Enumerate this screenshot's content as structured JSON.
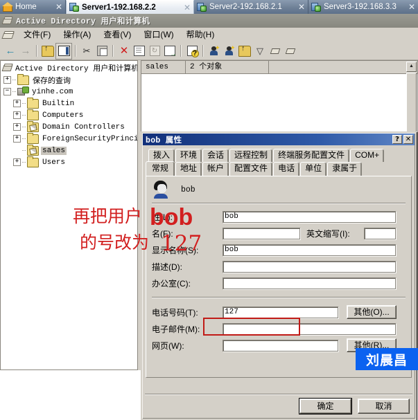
{
  "browser": {
    "tabs": [
      {
        "label": "Home",
        "icon": "home-icon",
        "active": false,
        "close": "✕"
      },
      {
        "label": "Server1-192.168.2.2",
        "icon": "server-icon",
        "active": true,
        "close": "✕"
      },
      {
        "label": "Server2-192.168.2.1",
        "icon": "server-icon",
        "active": false,
        "close": "✕"
      },
      {
        "label": "Server3-192.168.3.3",
        "icon": "server-icon",
        "active": false,
        "close": "✕"
      }
    ]
  },
  "mmc": {
    "window_title": "Active Directory 用户和计算机",
    "menu": [
      {
        "label": "文件(F)"
      },
      {
        "label": "操作(A)"
      },
      {
        "label": "查看(V)"
      },
      {
        "label": "窗口(W)"
      },
      {
        "label": "帮助(H)"
      }
    ],
    "toolbar": [
      {
        "name": "back-button",
        "glyph": "←"
      },
      {
        "name": "forward-button",
        "glyph": "→"
      },
      {
        "name": "up-one-level-button",
        "glyph": ""
      },
      {
        "name": "show-hide-tree-button",
        "glyph": ""
      },
      {
        "name": "cut-button",
        "glyph": "✂"
      },
      {
        "name": "copy-button",
        "glyph": ""
      },
      {
        "name": "delete-button",
        "glyph": "✕"
      },
      {
        "name": "properties-button",
        "glyph": ""
      },
      {
        "name": "refresh-button",
        "glyph": "↻"
      },
      {
        "name": "export-list-button",
        "glyph": ""
      },
      {
        "name": "help-button",
        "glyph": "?"
      },
      {
        "name": "new-user-button",
        "glyph": ""
      },
      {
        "name": "new-group-button",
        "glyph": ""
      },
      {
        "name": "new-computer-button",
        "glyph": ""
      },
      {
        "name": "filter-button",
        "glyph": "▽"
      },
      {
        "name": "find-button",
        "glyph": ""
      },
      {
        "name": "saved-query-button",
        "glyph": ""
      }
    ],
    "tree": {
      "root_label": "Active Directory 用户和计算机",
      "nodes": [
        {
          "label": "保存的查询",
          "icon": "folder-icon",
          "expander": "+",
          "level": 1,
          "selected": false
        },
        {
          "label": "yinhe.com",
          "icon": "domain-icon",
          "expander": "−",
          "level": 1,
          "selected": false
        },
        {
          "label": "Builtin",
          "icon": "folder-icon",
          "expander": "+",
          "level": 2,
          "selected": false
        },
        {
          "label": "Computers",
          "icon": "folder-icon",
          "expander": "+",
          "level": 2,
          "selected": false
        },
        {
          "label": "Domain Controllers",
          "icon": "ou-folder-icon",
          "expander": "+",
          "level": 2,
          "selected": false
        },
        {
          "label": "ForeignSecurityPrincipals",
          "icon": "folder-icon",
          "expander": "+",
          "level": 2,
          "selected": false
        },
        {
          "label": "sales",
          "icon": "ou-folder-icon",
          "expander": "",
          "level": 2,
          "selected": true
        },
        {
          "label": "Users",
          "icon": "folder-icon",
          "expander": "+",
          "level": 2,
          "selected": false
        }
      ]
    },
    "list": {
      "columns": [
        {
          "label": "sales"
        },
        {
          "label": "2 个对象"
        }
      ]
    }
  },
  "dialog": {
    "title": "bob 属性",
    "titlebar_buttons": [
      {
        "name": "help-button",
        "glyph": "?"
      },
      {
        "name": "close-button",
        "glyph": "✕"
      }
    ],
    "tabs_row1": [
      {
        "label": "拨入",
        "active": false
      },
      {
        "label": "环境",
        "active": false
      },
      {
        "label": "会话",
        "active": false
      },
      {
        "label": "远程控制",
        "active": false
      },
      {
        "label": "终端服务配置文件",
        "active": false
      },
      {
        "label": "COM+",
        "active": false
      }
    ],
    "tabs_row2": [
      {
        "label": "常规",
        "active": true
      },
      {
        "label": "地址",
        "active": false
      },
      {
        "label": "帐户",
        "active": false
      },
      {
        "label": "配置文件",
        "active": false
      },
      {
        "label": "电话",
        "active": false
      },
      {
        "label": "单位",
        "active": false
      },
      {
        "label": "隶属于",
        "active": false
      }
    ],
    "header_user": "bob",
    "fields": [
      {
        "name": "last-name",
        "label": "姓(L):",
        "value": "bob",
        "placeholder": ""
      },
      {
        "name": "first-name",
        "label": "名(F):",
        "value": "",
        "placeholder": ""
      },
      {
        "name": "initials",
        "label": "英文缩写(I):",
        "value": "",
        "placeholder": ""
      },
      {
        "name": "display-name",
        "label": "显示名称(S):",
        "value": "bob",
        "placeholder": ""
      },
      {
        "name": "description",
        "label": "描述(D):",
        "value": "",
        "placeholder": ""
      },
      {
        "name": "office",
        "label": "办公室(C):",
        "value": "",
        "placeholder": ""
      },
      {
        "name": "telephone",
        "label": "电话号码(T):",
        "value": "127",
        "placeholder": ""
      },
      {
        "name": "email",
        "label": "电子邮件(M):",
        "value": "",
        "placeholder": ""
      },
      {
        "name": "webpage",
        "label": "网页(W):",
        "value": "",
        "placeholder": ""
      }
    ],
    "other_phone_button": "其他(O)...",
    "other_web_button": "其他(R)...",
    "ok_button": "确定",
    "cancel_button": "取消"
  },
  "annotations": {
    "line1": "再把用户",
    "line2": "的号改为",
    "bob": "bob",
    "number": "127",
    "signature": "刘晨昌",
    "highlight_color": "#c11a16",
    "annotation_color": "#d21f1f",
    "signature_bg": "#0b62f0"
  }
}
